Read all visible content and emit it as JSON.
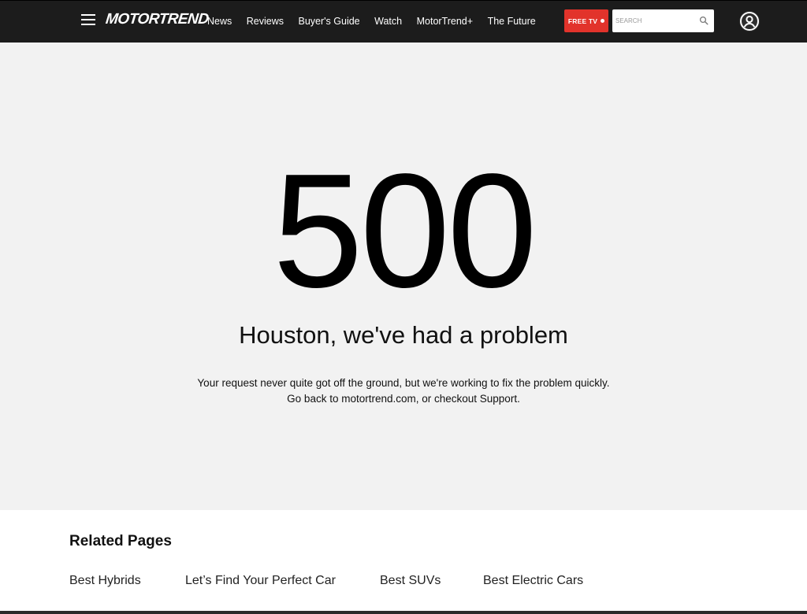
{
  "header": {
    "logo": "MOTORTREND",
    "nav": [
      "News",
      "Reviews",
      "Buyer's Guide",
      "Watch",
      "MotorTrend+",
      "The Future"
    ],
    "free_tv_label": "FREE TV",
    "search_placeholder": "SEARCH"
  },
  "error": {
    "code": "500",
    "title": "Houston, we've had a problem",
    "line1": "Your request never quite got off the ground, but we're working to fix the problem quickly.",
    "line2": "Go back to motortrend.com, or checkout Support."
  },
  "related": {
    "title": "Related Pages",
    "links": [
      "Best Hybrids",
      "Let’s Find Your Perfect Car",
      "Best SUVs",
      "Best Electric Cars"
    ]
  },
  "colors": {
    "header_bg": "#1c1c1c",
    "hero_bg": "#f2f2f2",
    "accent_red": "#e2332b"
  }
}
